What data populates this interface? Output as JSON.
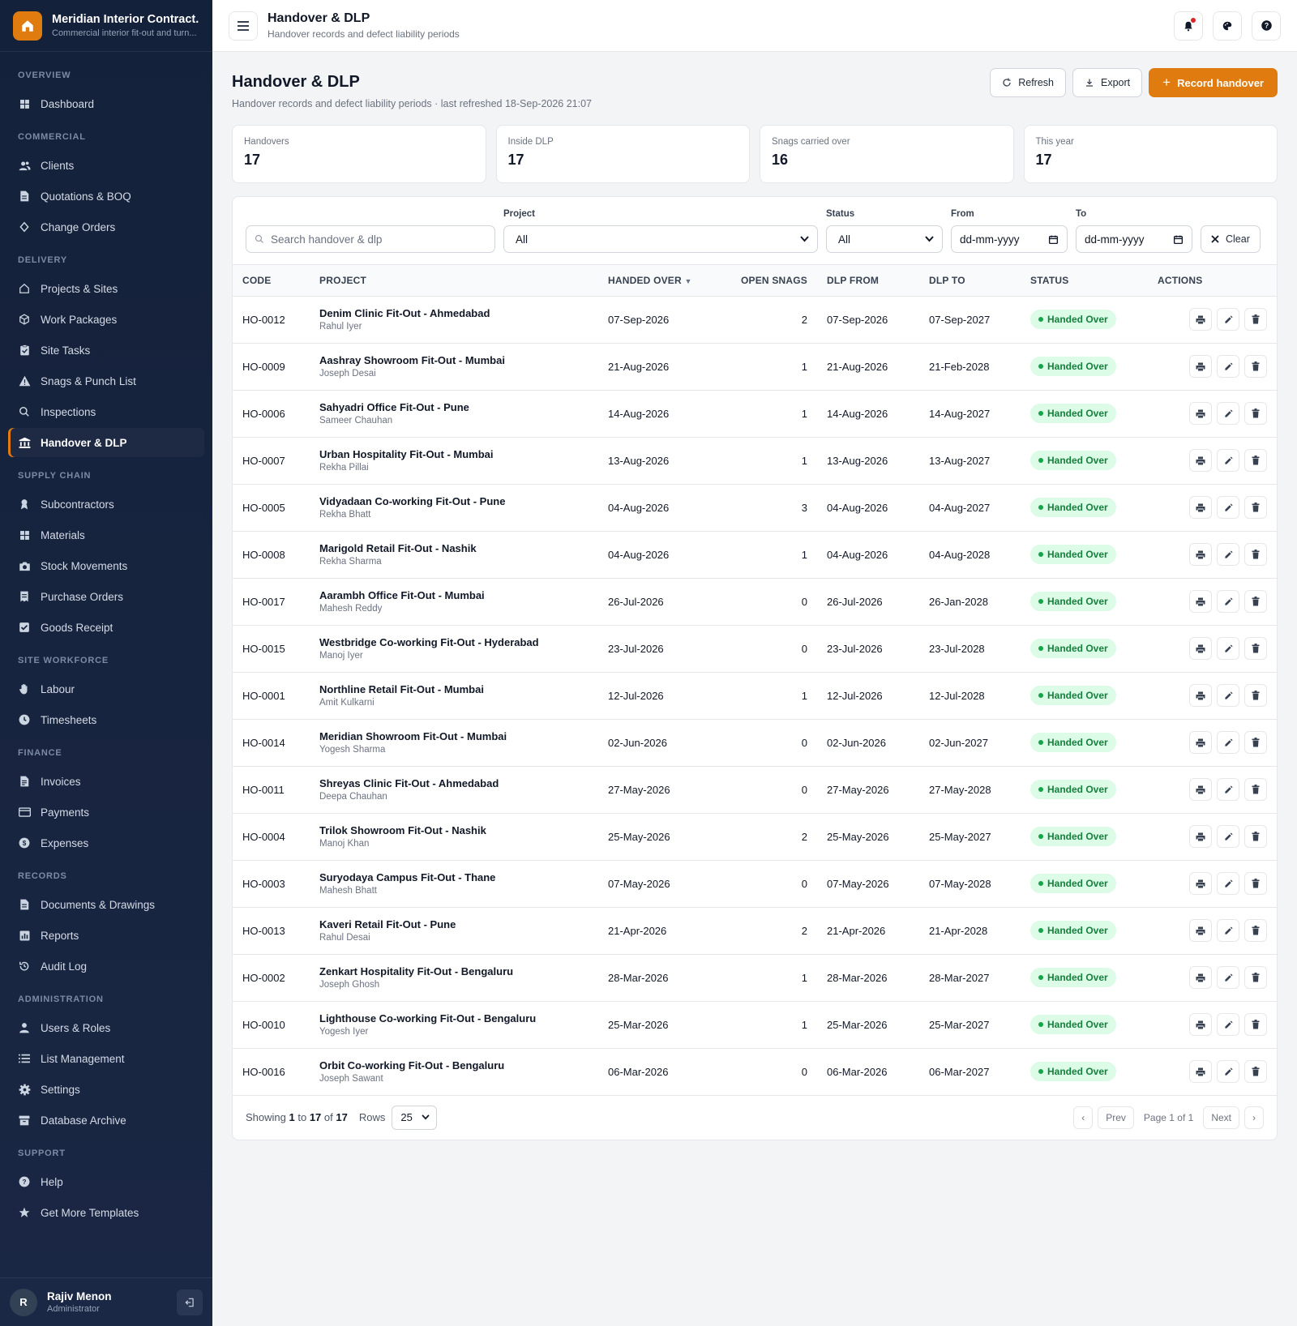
{
  "brand": {
    "name": "Meridian Interior Contract...",
    "subtitle": "Commercial interior fit-out and turn...",
    "logo_icon": "home-icon",
    "accent_color": "#e07b10"
  },
  "sidebar": {
    "sections": [
      {
        "title": "OVERVIEW",
        "items": [
          {
            "label": "Dashboard",
            "icon": "grid-icon"
          }
        ]
      },
      {
        "title": "COMMERCIAL",
        "items": [
          {
            "label": "Clients",
            "icon": "users-icon"
          },
          {
            "label": "Quotations & BOQ",
            "icon": "file-icon"
          },
          {
            "label": "Change Orders",
            "icon": "swap-icon"
          }
        ]
      },
      {
        "title": "DELIVERY",
        "items": [
          {
            "label": "Projects & Sites",
            "icon": "home-icon"
          },
          {
            "label": "Work Packages",
            "icon": "package-icon"
          },
          {
            "label": "Site Tasks",
            "icon": "clipboard-icon"
          },
          {
            "label": "Snags & Punch List",
            "icon": "warning-icon"
          },
          {
            "label": "Inspections",
            "icon": "search-icon"
          },
          {
            "label": "Handover & DLP",
            "icon": "bank-icon",
            "active": true
          }
        ]
      },
      {
        "title": "SUPPLY CHAIN",
        "items": [
          {
            "label": "Subcontractors",
            "icon": "badge-icon"
          },
          {
            "label": "Materials",
            "icon": "grid-icon"
          },
          {
            "label": "Stock Movements",
            "icon": "camera-icon"
          },
          {
            "label": "Purchase Orders",
            "icon": "receipt-icon"
          },
          {
            "label": "Goods Receipt",
            "icon": "check-square-icon"
          }
        ]
      },
      {
        "title": "SITE WORKFORCE",
        "items": [
          {
            "label": "Labour",
            "icon": "hand-icon"
          },
          {
            "label": "Timesheets",
            "icon": "clock-icon"
          }
        ]
      },
      {
        "title": "FINANCE",
        "items": [
          {
            "label": "Invoices",
            "icon": "invoice-icon"
          },
          {
            "label": "Payments",
            "icon": "card-icon"
          },
          {
            "label": "Expenses",
            "icon": "dollar-icon"
          }
        ]
      },
      {
        "title": "RECORDS",
        "items": [
          {
            "label": "Documents & Drawings",
            "icon": "file-icon"
          },
          {
            "label": "Reports",
            "icon": "chart-icon"
          },
          {
            "label": "Audit Log",
            "icon": "history-icon"
          }
        ]
      },
      {
        "title": "ADMINISTRATION",
        "items": [
          {
            "label": "Users & Roles",
            "icon": "user-icon"
          },
          {
            "label": "List Management",
            "icon": "list-icon"
          },
          {
            "label": "Settings",
            "icon": "gear-icon"
          },
          {
            "label": "Database Archive",
            "icon": "archive-icon"
          }
        ]
      },
      {
        "title": "SUPPORT",
        "items": [
          {
            "label": "Help",
            "icon": "help-icon"
          },
          {
            "label": "Get More Templates",
            "icon": "star-icon"
          }
        ]
      }
    ]
  },
  "user": {
    "initial": "R",
    "name": "Rajiv Menon",
    "role": "Administrator"
  },
  "topbar": {
    "title": "Handover & DLP",
    "subtitle": "Handover records and defect liability periods"
  },
  "page": {
    "title": "Handover & DLP",
    "subtitle": "Handover records and defect liability periods · last refreshed 18-Sep-2026 21:07",
    "refresh_label": "Refresh",
    "export_label": "Export",
    "record_label": "Record handover"
  },
  "stats": [
    {
      "label": "Handovers",
      "value": "17"
    },
    {
      "label": "Inside DLP",
      "value": "17"
    },
    {
      "label": "Snags carried over",
      "value": "16"
    },
    {
      "label": "This year",
      "value": "17"
    }
  ],
  "filters": {
    "search_placeholder": "Search handover & dlp",
    "project_label": "Project",
    "project_value": "All",
    "status_label": "Status",
    "status_value": "All",
    "from_label": "From",
    "from_value": "dd-mm-yyyy",
    "to_label": "To",
    "to_value": "dd-mm-yyyy",
    "clear_label": "Clear"
  },
  "table": {
    "columns": [
      "CODE",
      "PROJECT",
      "HANDED OVER",
      "OPEN SNAGS",
      "DLP FROM",
      "DLP TO",
      "STATUS",
      "ACTIONS"
    ],
    "sort_indicator": "▼",
    "rows": [
      {
        "code": "HO-0012",
        "project": "Denim Clinic Fit-Out - Ahmedabad",
        "client": "Rahul Iyer",
        "handed": "07-Sep-2026",
        "snags": "2",
        "from": "07-Sep-2026",
        "to": "07-Sep-2027",
        "status": "Handed Over"
      },
      {
        "code": "HO-0009",
        "project": "Aashray Showroom Fit-Out - Mumbai",
        "client": "Joseph Desai",
        "handed": "21-Aug-2026",
        "snags": "1",
        "from": "21-Aug-2026",
        "to": "21-Feb-2028",
        "status": "Handed Over"
      },
      {
        "code": "HO-0006",
        "project": "Sahyadri Office Fit-Out - Pune",
        "client": "Sameer Chauhan",
        "handed": "14-Aug-2026",
        "snags": "1",
        "from": "14-Aug-2026",
        "to": "14-Aug-2027",
        "status": "Handed Over"
      },
      {
        "code": "HO-0007",
        "project": "Urban Hospitality Fit-Out - Mumbai",
        "client": "Rekha Pillai",
        "handed": "13-Aug-2026",
        "snags": "1",
        "from": "13-Aug-2026",
        "to": "13-Aug-2027",
        "status": "Handed Over"
      },
      {
        "code": "HO-0005",
        "project": "Vidyadaan Co-working Fit-Out - Pune",
        "client": "Rekha Bhatt",
        "handed": "04-Aug-2026",
        "snags": "3",
        "from": "04-Aug-2026",
        "to": "04-Aug-2027",
        "status": "Handed Over"
      },
      {
        "code": "HO-0008",
        "project": "Marigold Retail Fit-Out - Nashik",
        "client": "Rekha Sharma",
        "handed": "04-Aug-2026",
        "snags": "1",
        "from": "04-Aug-2026",
        "to": "04-Aug-2028",
        "status": "Handed Over"
      },
      {
        "code": "HO-0017",
        "project": "Aarambh Office Fit-Out - Mumbai",
        "client": "Mahesh Reddy",
        "handed": "26-Jul-2026",
        "snags": "0",
        "from": "26-Jul-2026",
        "to": "26-Jan-2028",
        "status": "Handed Over"
      },
      {
        "code": "HO-0015",
        "project": "Westbridge Co-working Fit-Out - Hyderabad",
        "client": "Manoj Iyer",
        "handed": "23-Jul-2026",
        "snags": "0",
        "from": "23-Jul-2026",
        "to": "23-Jul-2028",
        "status": "Handed Over"
      },
      {
        "code": "HO-0001",
        "project": "Northline Retail Fit-Out - Mumbai",
        "client": "Amit Kulkarni",
        "handed": "12-Jul-2026",
        "snags": "1",
        "from": "12-Jul-2026",
        "to": "12-Jul-2028",
        "status": "Handed Over"
      },
      {
        "code": "HO-0014",
        "project": "Meridian Showroom Fit-Out - Mumbai",
        "client": "Yogesh Sharma",
        "handed": "02-Jun-2026",
        "snags": "0",
        "from": "02-Jun-2026",
        "to": "02-Jun-2027",
        "status": "Handed Over"
      },
      {
        "code": "HO-0011",
        "project": "Shreyas Clinic Fit-Out - Ahmedabad",
        "client": "Deepa Chauhan",
        "handed": "27-May-2026",
        "snags": "0",
        "from": "27-May-2026",
        "to": "27-May-2028",
        "status": "Handed Over"
      },
      {
        "code": "HO-0004",
        "project": "Trilok Showroom Fit-Out - Nashik",
        "client": "Manoj Khan",
        "handed": "25-May-2026",
        "snags": "2",
        "from": "25-May-2026",
        "to": "25-May-2027",
        "status": "Handed Over"
      },
      {
        "code": "HO-0003",
        "project": "Suryodaya Campus Fit-Out - Thane",
        "client": "Mahesh Bhatt",
        "handed": "07-May-2026",
        "snags": "0",
        "from": "07-May-2026",
        "to": "07-May-2028",
        "status": "Handed Over"
      },
      {
        "code": "HO-0013",
        "project": "Kaveri Retail Fit-Out - Pune",
        "client": "Rahul Desai",
        "handed": "21-Apr-2026",
        "snags": "2",
        "from": "21-Apr-2026",
        "to": "21-Apr-2028",
        "status": "Handed Over"
      },
      {
        "code": "HO-0002",
        "project": "Zenkart Hospitality Fit-Out - Bengaluru",
        "client": "Joseph Ghosh",
        "handed": "28-Mar-2026",
        "snags": "1",
        "from": "28-Mar-2026",
        "to": "28-Mar-2027",
        "status": "Handed Over"
      },
      {
        "code": "HO-0010",
        "project": "Lighthouse Co-working Fit-Out - Bengaluru",
        "client": "Yogesh Iyer",
        "handed": "25-Mar-2026",
        "snags": "1",
        "from": "25-Mar-2026",
        "to": "25-Mar-2027",
        "status": "Handed Over"
      },
      {
        "code": "HO-0016",
        "project": "Orbit Co-working Fit-Out - Bengaluru",
        "client": "Joseph Sawant",
        "handed": "06-Mar-2026",
        "snags": "0",
        "from": "06-Mar-2026",
        "to": "06-Mar-2027",
        "status": "Handed Over"
      }
    ]
  },
  "footer": {
    "showing_prefix": "Showing",
    "from": "1",
    "to_word": "to",
    "to": "17",
    "of_word": "of",
    "total": "17",
    "rows_label": "Rows",
    "rows_value": "25",
    "prev_label": "Prev",
    "page_label": "Page 1 of 1",
    "next_label": "Next"
  }
}
